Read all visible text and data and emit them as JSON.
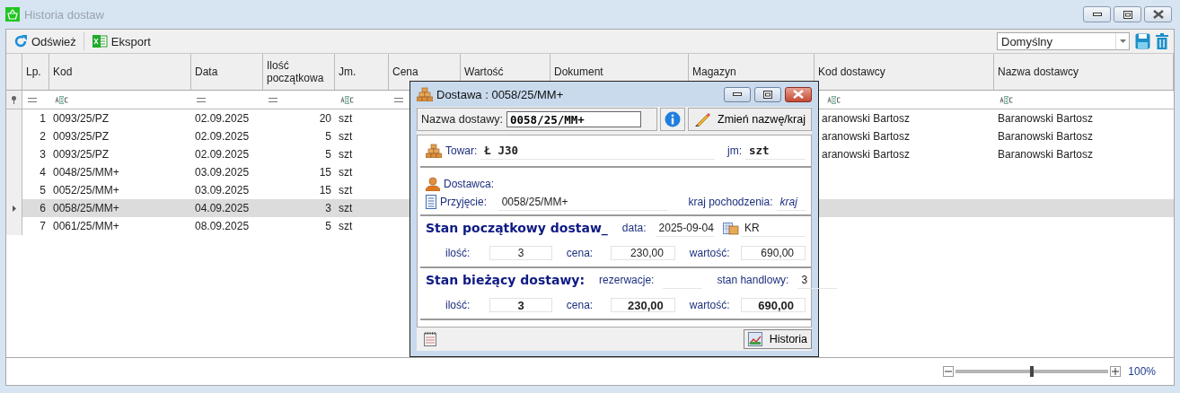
{
  "window": {
    "title": "Historia dostaw"
  },
  "toolbar": {
    "buttons": [
      {
        "kind": "refresh",
        "label": "Odśwież"
      },
      {
        "kind": "excel",
        "label": "Eksport"
      }
    ],
    "layout_select": {
      "value": "Domyślny"
    }
  },
  "table": {
    "columns": [
      {
        "title": "Lp.",
        "kind": "number",
        "filter": true
      },
      {
        "title": "Kod",
        "kind": "text",
        "filter": true
      },
      {
        "title": "Data",
        "kind": "date",
        "filter": true
      },
      {
        "title": "Ilość początkowa",
        "kind": "number",
        "filter": true
      },
      {
        "title": "Jm.",
        "kind": "text",
        "filter": true
      },
      {
        "title": "Cena",
        "kind": "number",
        "filter": true
      },
      {
        "title": "Wartość",
        "kind": "number"
      },
      {
        "title": "Dokument",
        "kind": "text"
      },
      {
        "title": "Magazyn",
        "kind": "text"
      },
      {
        "title": "Kod dostawcy",
        "kind": "text",
        "filter": true
      },
      {
        "title": "Nazwa dostawcy",
        "kind": "text",
        "filter": true
      }
    ],
    "rows": [
      {
        "selected": false,
        "cells": [
          "1",
          "0093/25/PZ",
          "02.09.2025",
          "20",
          "szt",
          "",
          "",
          "",
          "",
          "aranowski Bartosz",
          "Baranowski Bartosz"
        ]
      },
      {
        "selected": false,
        "cells": [
          "2",
          "0093/25/PZ",
          "02.09.2025",
          "5",
          "szt",
          "",
          "",
          "",
          "",
          "aranowski Bartosz",
          "Baranowski Bartosz"
        ]
      },
      {
        "selected": false,
        "cells": [
          "3",
          "0093/25/PZ",
          "02.09.2025",
          "5",
          "szt",
          "",
          "",
          "",
          "",
          "aranowski Bartosz",
          "Baranowski Bartosz"
        ]
      },
      {
        "selected": false,
        "cells": [
          "4",
          "0048/25/MM+",
          "03.09.2025",
          "15",
          "szt",
          "",
          "",
          "",
          "",
          "",
          ""
        ]
      },
      {
        "selected": false,
        "cells": [
          "5",
          "0052/25/MM+",
          "03.09.2025",
          "15",
          "szt",
          "",
          "",
          "",
          "",
          "",
          ""
        ]
      },
      {
        "selected": true,
        "cells": [
          "6",
          "0058/25/MM+",
          "04.09.2025",
          "3",
          "szt",
          "",
          "",
          "",
          "",
          "",
          ""
        ]
      },
      {
        "selected": false,
        "cells": [
          "7",
          "0061/25/MM+",
          "08.09.2025",
          "5",
          "szt",
          "",
          "",
          "",
          "",
          "",
          ""
        ]
      }
    ]
  },
  "dialog": {
    "title": "Dostawa : 0058/25/MM+",
    "name_field": {
      "label": "Nazwa dostawy:",
      "value": "0058/25/MM+"
    },
    "rename_button": "Zmień nazwę/kraj",
    "product": {
      "label": "Towar:",
      "value": "Ł J30",
      "unit_label": "jm:",
      "unit": "szt"
    },
    "supplier": {
      "label": "Dostawca:"
    },
    "receipt": {
      "label": "Przyjęcie:",
      "value": "0058/25/MM+",
      "country_label": "kraj pochodzenia:",
      "country_placeholder": "kraj"
    },
    "sections": [
      {
        "heading": "Stan początkowy dostaw_",
        "bold": false,
        "extra": [
          {
            "kind": "text",
            "label": "data:",
            "value": "2025-09-04"
          },
          {
            "kind": "warehouse",
            "value": "KR"
          }
        ],
        "fields": [
          {
            "label": "ilość:",
            "value": "3"
          },
          {
            "label": "cena:",
            "value": "230,00"
          },
          {
            "label": "wartość:",
            "value": "690,00"
          }
        ]
      },
      {
        "heading": "Stan bieżący dostawy:",
        "bold": true,
        "extra": [
          {
            "kind": "text",
            "label": "rezerwacje:"
          },
          {
            "kind": "text",
            "label": "stan handlowy:",
            "value": "3"
          }
        ],
        "fields": [
          {
            "label": "ilość:",
            "value": "3"
          },
          {
            "label": "cena:",
            "value": "230,00"
          },
          {
            "label": "wartość:",
            "value": "690,00"
          }
        ]
      }
    ],
    "history_button": "Historia"
  },
  "zoom": {
    "level": 0.5,
    "reading": "100%"
  }
}
